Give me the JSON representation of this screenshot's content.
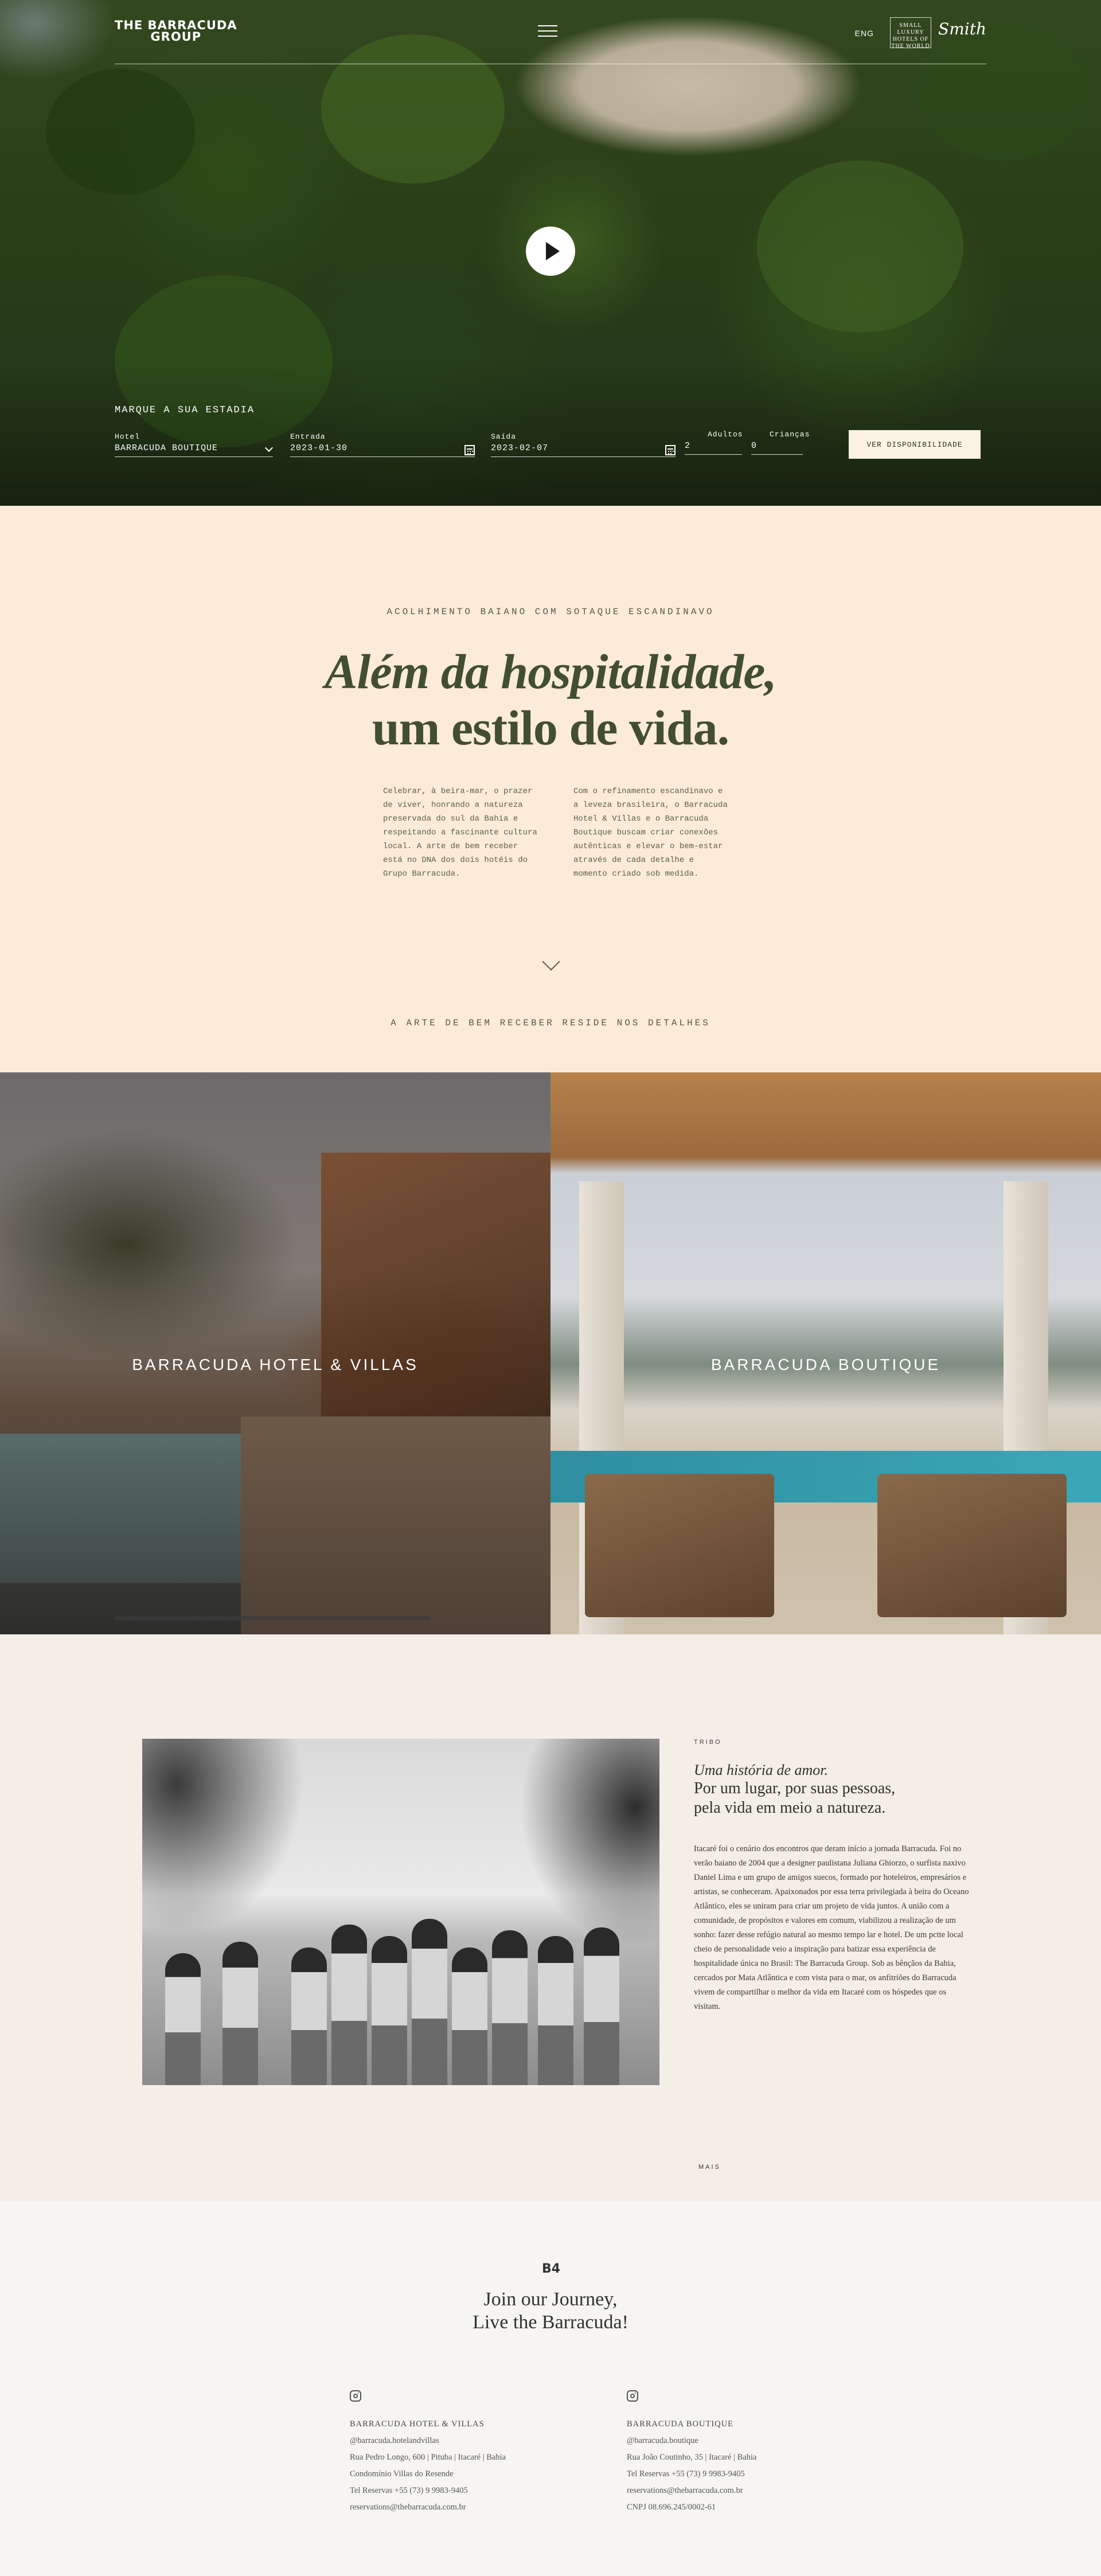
{
  "header": {
    "logo_line1": "THE BARRACUDA",
    "logo_line2": "GROUP",
    "language": "ENG",
    "badge_slh": "SMALL LUXURY HOTELS OF THE WORLD",
    "badge_script": "Smith"
  },
  "booking": {
    "title": "MARQUE A SUA ESTADIA",
    "fields": [
      {
        "label": "Hotel",
        "value": "BARRACUDA BOUTIQUE"
      },
      {
        "label": "Entrada",
        "value": "2023-01-30"
      },
      {
        "label": "Saída",
        "value": "2023-02-07"
      },
      {
        "label": "Adultos",
        "value": "2"
      },
      {
        "label": "Crianças",
        "value": "0"
      }
    ],
    "button": "VER DISPONIBILIDADE"
  },
  "intro": {
    "eyebrow": "ACOLHIMENTO BAIANO COM SOTAQUE ESCANDINAVO",
    "headline_line1": "Além da hospitalidade,",
    "headline_line2": "um estilo de vida.",
    "col1": "Celebrar, à beira-mar, o prazer de viver, honrando a natureza preservada do sul da Bahia e respeitando a fascinante cultura local. A arte de bem receber está no DNA dos dois hotéis do Grupo Barracuda.",
    "col2": "Com o refinamento escandinavo e a leveza brasileira, o Barracuda Hotel & Villas e o Barracuda Boutique buscam criar conexões autênticas e elevar o bem-estar através de cada detalhe e momento criado sob medida.",
    "eyebrow2": "A ARTE DE BEM RECEBER RESIDE NOS DETALHES"
  },
  "properties": [
    {
      "name": "BARRACUDA HOTEL & VILLAS"
    },
    {
      "name": "BARRACUDA BOUTIQUE"
    }
  ],
  "story": {
    "tag": "TRIBO",
    "italic": "Uma história de amor.",
    "line1": "Por um lugar, por suas pessoas,",
    "line2": "pela vida em meio a natureza.",
    "body": "Itacaré foi o cenário dos encontros que deram início a jornada Barracuda. Foi no verão baiano de 2004 que a designer paulistana Juliana Ghiorzo, o surfista naxivo Daniel Lima e um grupo de amigos suecos, formado por hoteleiros, empresários e artistas, se conheceram. Apaixonados por essa terra privilegiada à beira do Oceano Atlântico, eles se uniram para criar um projeto de vida juntos. A união com a comunidade, de propósitos e valores em comum, viabilizou a realização de um sonho: fazer desse refúgio natural ao mesmo tempo lar e hotel. De um pctte local cheio de personalidade veio a inspiração para batizar essa experiência de hospitalidade única no Brasil: The Barracuda Group. Sob as bênçãos da Bahia, cercados por Mata Atlântica e com vista para o mar, os anfitriões do Barracuda vivem de compartilhar o melhor da vida em Itacaré com os hóspedes que os visitam.",
    "more": "MAIS"
  },
  "footer": {
    "mark": "B4",
    "join_line1": "Join our Journey,",
    "join_line2": "Live the Barracuda!",
    "columns": [
      {
        "title": "BARRACUDA HOTEL & VILLAS",
        "instagram": "@barracuda.hotelandvillas",
        "address1": "Rua Pedro Longo, 600 | Pituba | Itacaré | Bahia",
        "address2": "Condomínio Villas do Resende",
        "phone": "Tel Reservas +55 (73) 9 9983-9405",
        "email": "reservations@thebarracuda.com.br"
      },
      {
        "title": "BARRACUDA BOUTIQUE",
        "instagram": "@barracuda.boutique",
        "address1": "Rua João Coutinho, 35 | Itacaré | Bahia",
        "phone": "Tel Reservas +55 (73) 9 9983-9405",
        "email": "reservations@thebarracuda.com.br",
        "cnpj": "CNPJ 08.696.245/0002-61"
      }
    ]
  }
}
